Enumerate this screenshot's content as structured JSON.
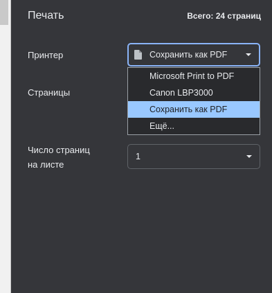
{
  "header": {
    "title": "Печать",
    "total": "Всего: 24 страниц"
  },
  "printer": {
    "label": "Принтер",
    "selected": "Сохранить как PDF",
    "icon": "document-icon",
    "options": [
      "Microsoft Print to PDF",
      "Canon LBP3000",
      "Сохранить как PDF",
      "Ещё..."
    ],
    "selected_index": 2
  },
  "pages": {
    "label": "Страницы"
  },
  "pages_per_sheet": {
    "label_line1": "Число страниц",
    "label_line2": "на листе",
    "value": "1"
  },
  "colors": {
    "panel": "#35363a",
    "accent": "#8ab4f8",
    "highlight": "#99c8ff"
  }
}
